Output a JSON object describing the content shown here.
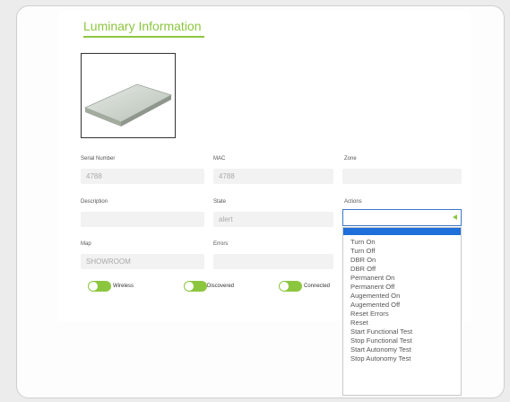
{
  "section_title": "Luminary Information",
  "fields": {
    "serial_number": {
      "label": "Serial Number",
      "value": "4788"
    },
    "mac": {
      "label": "MAC",
      "value": "4788"
    },
    "zone": {
      "label": "Zone",
      "value": ""
    },
    "description": {
      "label": "Description",
      "value": ""
    },
    "state": {
      "label": "State",
      "value": "alert"
    },
    "actions": {
      "label": "Actions",
      "value": ""
    },
    "map": {
      "label": "Map",
      "value": "SHOWROOM"
    },
    "errors": {
      "label": "Errors",
      "value": ""
    }
  },
  "toggles": {
    "wireless": {
      "label": "Wireless",
      "on": true
    },
    "discovered": {
      "label": "Discovered",
      "on": true
    },
    "connected": {
      "label": "Connected",
      "on": true
    }
  },
  "actions_options": [
    "Turn On",
    "Turn Off",
    "DBR On",
    "DBR Off",
    "Permanent On",
    "Permanent Off",
    "Augemented On",
    "Augemented Off",
    "Reset Errors",
    "Reset",
    "Start Functional Test",
    "Stop Functional Test",
    "Start Autonomy Test",
    "Stop Autonomy Test"
  ],
  "colors": {
    "accent": "#8cc63f",
    "selection": "#1e6fd9"
  }
}
